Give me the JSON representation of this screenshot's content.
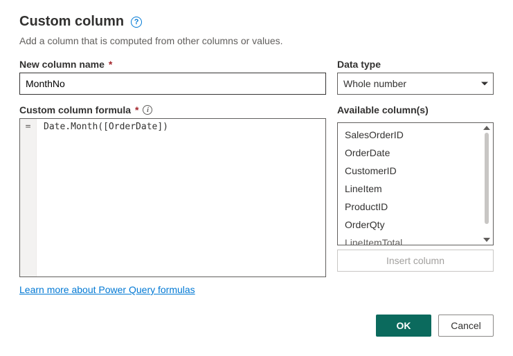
{
  "header": {
    "title": "Custom column",
    "subtitle": "Add a column that is computed from other columns or values."
  },
  "fields": {
    "column_name_label": "New column name",
    "column_name_value": "MonthNo",
    "data_type_label": "Data type",
    "data_type_value": "Whole number",
    "formula_label": "Custom column formula",
    "formula_prefix": "=",
    "formula_value": "Date.Month([OrderDate])",
    "available_label": "Available column(s)"
  },
  "available_columns": [
    "SalesOrderID",
    "OrderDate",
    "CustomerID",
    "LineItem",
    "ProductID",
    "OrderQty",
    "LineItemTotal"
  ],
  "buttons": {
    "insert": "Insert column",
    "learn_more": "Learn more about Power Query formulas",
    "ok": "OK",
    "cancel": "Cancel"
  }
}
